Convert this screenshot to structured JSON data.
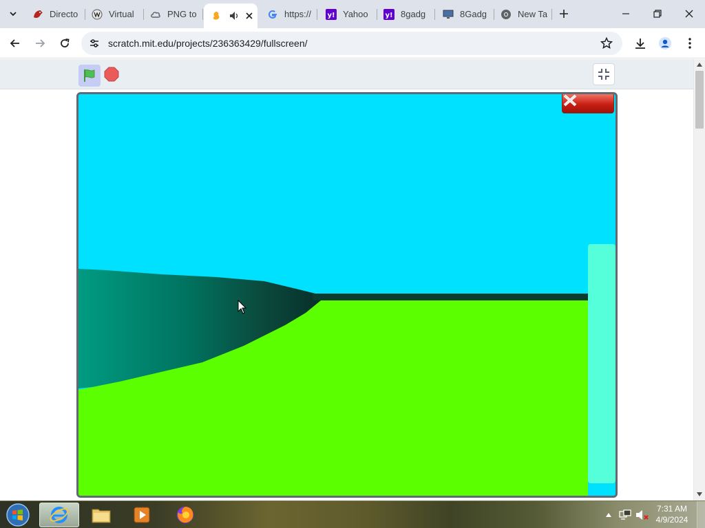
{
  "browser": {
    "tabs": [
      {
        "title": "Directo",
        "icon": "red-bird-favicon",
        "active": false
      },
      {
        "title": "Virtual",
        "icon": "wikipedia-favicon",
        "active": false
      },
      {
        "title": "PNG to",
        "icon": "cloud-favicon",
        "active": false
      },
      {
        "title": "",
        "icon": "scratch-favicon",
        "active": true,
        "audio": true
      },
      {
        "title": "https://",
        "icon": "google-favicon",
        "active": false
      },
      {
        "title": "Yahoo",
        "icon": "yahoo-favicon",
        "active": false
      },
      {
        "title": "8gadg",
        "icon": "yahoo-favicon",
        "active": false
      },
      {
        "title": "8Gadg",
        "icon": "monitor-favicon",
        "active": false
      },
      {
        "title": "New Ta",
        "icon": "chrome-favicon",
        "active": false
      }
    ],
    "url": "scratch.mit.edu/projects/236363429/fullscreen/",
    "colors": {
      "tabstrip": "#dee3eb",
      "omnibox": "#eef1f6"
    }
  },
  "scratch": {
    "stage_colors": {
      "sky": "#00e0ff",
      "grass": "#5cff00",
      "hill": "#008f7d",
      "hill_shadow": "#0c3b30",
      "pillar": "#55ffd9",
      "close_button": "#c91f14"
    },
    "close_label": "X"
  },
  "taskbar": {
    "time": "7:31 AM",
    "date": "4/9/2024",
    "apps": [
      "internet-explorer",
      "file-explorer",
      "media-player",
      "firefox"
    ]
  }
}
